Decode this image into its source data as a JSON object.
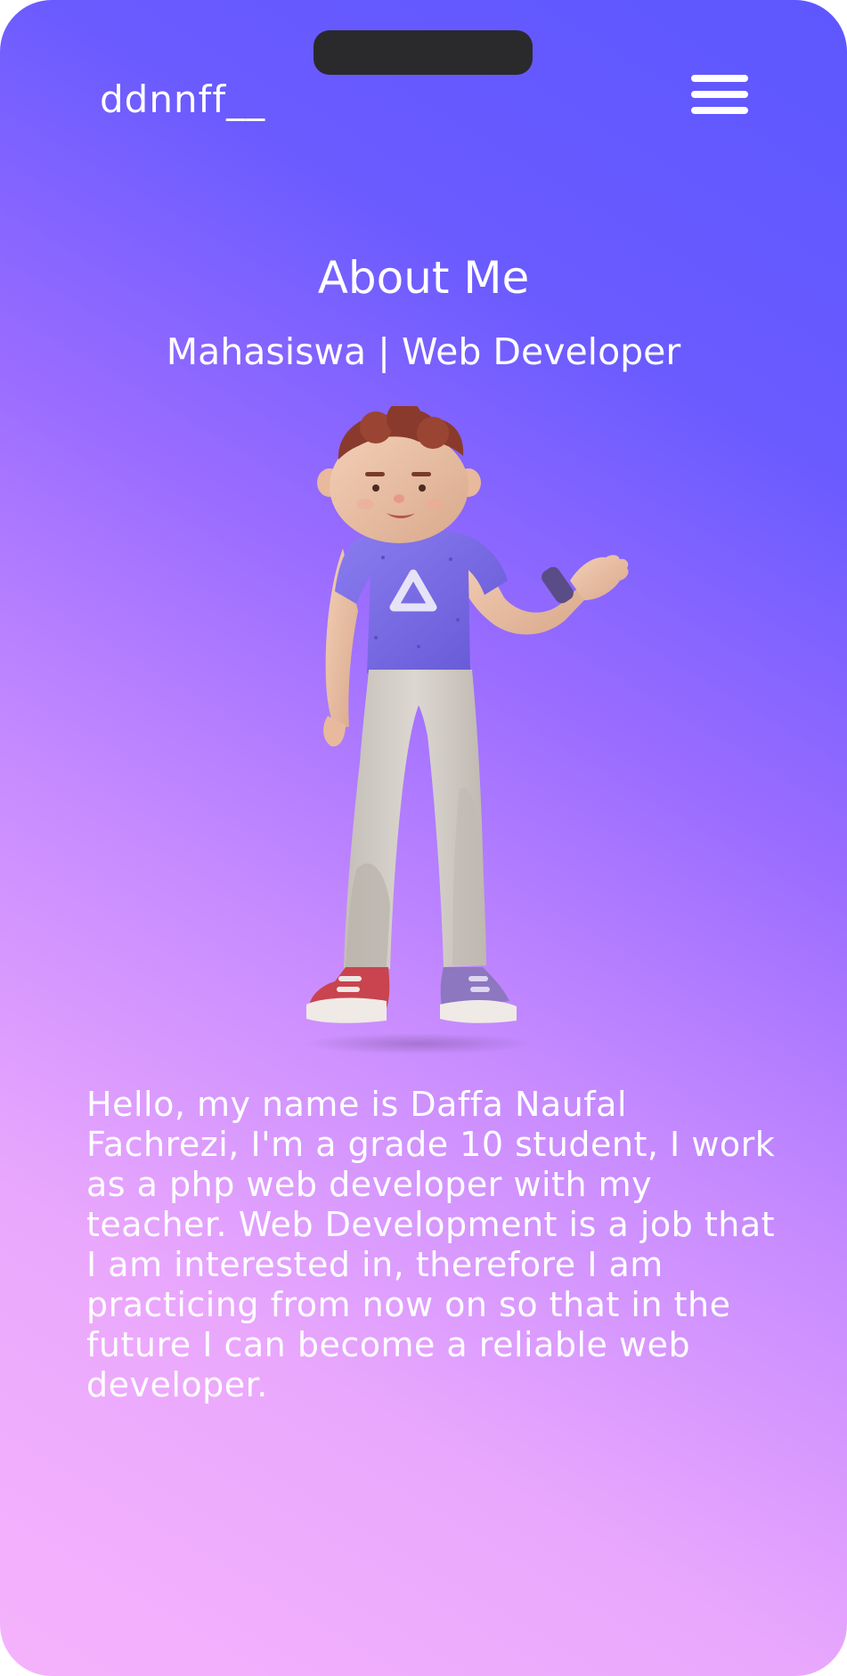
{
  "header": {
    "brand": "ddnnff__",
    "menu_icon": "hamburger-menu-icon"
  },
  "about": {
    "title": "About Me",
    "subtitle": "Mahasiswa | Web Developer",
    "illustration": "3d-character-waving",
    "bio": "Hello, my name is Daffa Naufal Fachrezi, I'm a grade 10 student, I work as a php web developer with my teacher. Web Development is a job that I am interested in, therefore I am practicing from now on so that in the future I can become a reliable web developer."
  },
  "colors": {
    "gradient_top_right": "#5d57ff",
    "gradient_bottom_left": "#f5b3fd",
    "text": "#ffffff",
    "shirt": "#7b6ae8",
    "pants": "#d2ccc6",
    "hair": "#8a3a2c",
    "left_shoe": "#c9444e",
    "right_shoe": "#8c77c0"
  }
}
